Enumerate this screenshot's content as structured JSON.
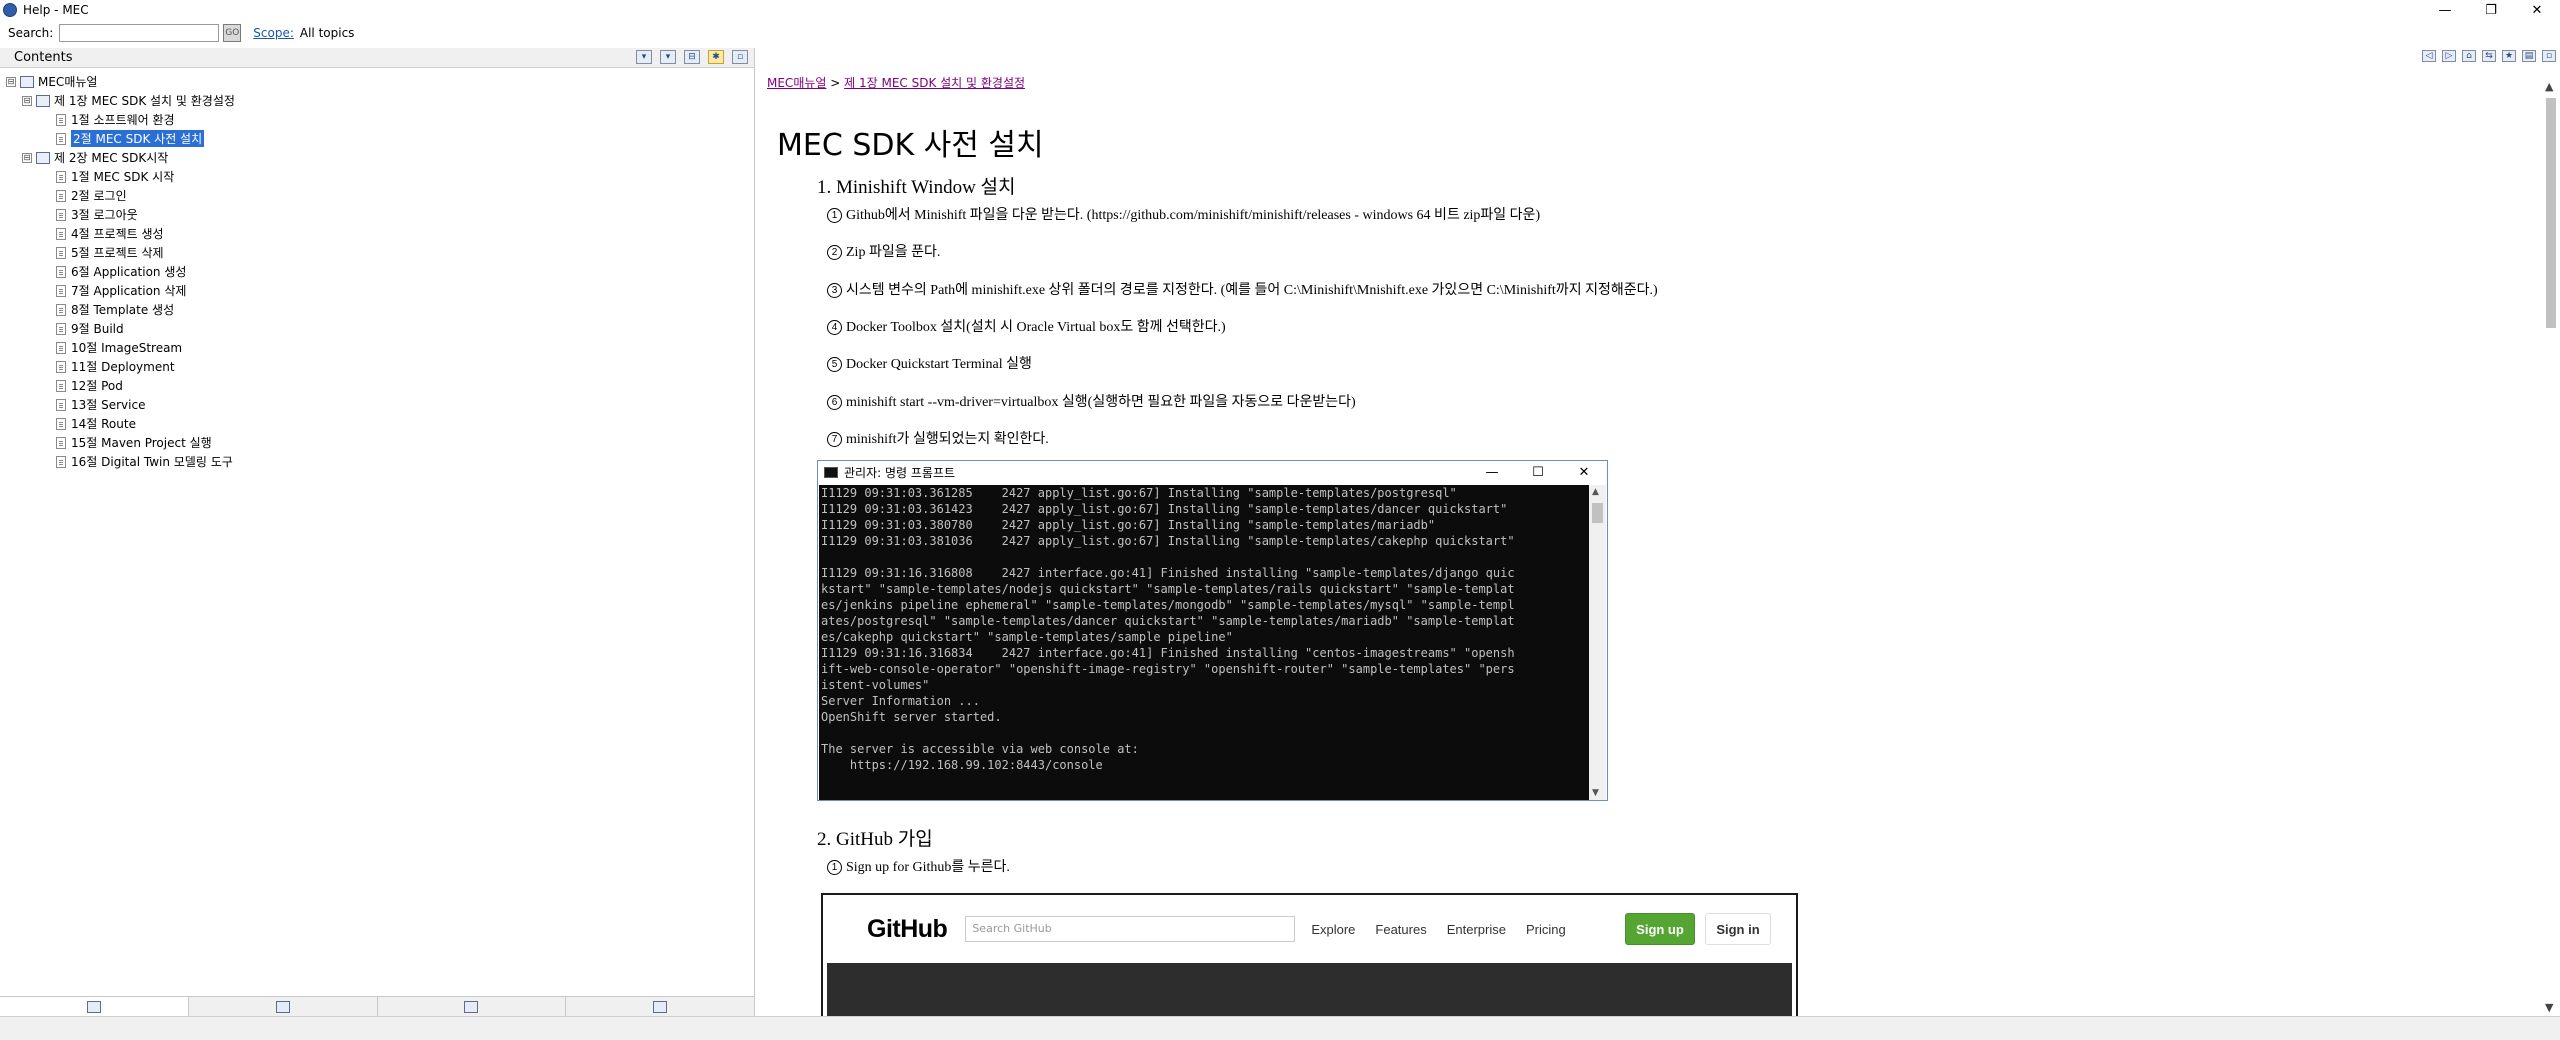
{
  "window": {
    "title": "Help - MEC",
    "controls": [
      "—",
      "❐",
      "✕"
    ]
  },
  "search": {
    "label": "Search:",
    "value": "",
    "go_label": "GO",
    "scope_link": "Scope:",
    "scope_value": "All topics"
  },
  "contents": {
    "header": "Contents",
    "tree": [
      {
        "label": "MEC매뉴얼",
        "level": 0,
        "type": "book",
        "toggle": "⊟"
      },
      {
        "label": "제 1장 MEC SDK 설치 및 환경설정",
        "level": 1,
        "type": "book",
        "toggle": "⊟"
      },
      {
        "label": "1절 소프트웨어 환경",
        "level": 2,
        "type": "page"
      },
      {
        "label": "2절 MEC SDK 사전 설치",
        "level": 2,
        "type": "page",
        "selected": true
      },
      {
        "label": "제 2장 MEC SDK시작",
        "level": 1,
        "type": "book",
        "toggle": "⊟"
      },
      {
        "label": "1절 MEC SDK 시작",
        "level": 2,
        "type": "page"
      },
      {
        "label": "2절 로그인",
        "level": 2,
        "type": "page"
      },
      {
        "label": "3절 로그아웃",
        "level": 2,
        "type": "page"
      },
      {
        "label": "4절 프로젝트 생성",
        "level": 2,
        "type": "page"
      },
      {
        "label": "5절 프로젝트 삭제",
        "level": 2,
        "type": "page"
      },
      {
        "label": "6절 Application 생성",
        "level": 2,
        "type": "page"
      },
      {
        "label": "7절 Application 삭제",
        "level": 2,
        "type": "page"
      },
      {
        "label": "8절 Template 생성",
        "level": 2,
        "type": "page"
      },
      {
        "label": "9절 Build",
        "level": 2,
        "type": "page"
      },
      {
        "label": "10절 ImageStream",
        "level": 2,
        "type": "page"
      },
      {
        "label": "11절 Deployment",
        "level": 2,
        "type": "page"
      },
      {
        "label": "12절 Pod",
        "level": 2,
        "type": "page"
      },
      {
        "label": "13절 Service",
        "level": 2,
        "type": "page"
      },
      {
        "label": "14절 Route",
        "level": 2,
        "type": "page"
      },
      {
        "label": "15절 Maven Project 실행",
        "level": 2,
        "type": "page"
      },
      {
        "label": "16절 Digital Twin 모델링 도구",
        "level": 2,
        "type": "page"
      }
    ]
  },
  "article": {
    "breadcrumb": [
      "MEC매뉴얼",
      " > ",
      "제 1장 MEC SDK 설치 및 환경설정"
    ],
    "title": "MEC SDK 사전 설치",
    "section1": "1. Minishift Window 설치",
    "steps1": [
      {
        "num": "1",
        "text": "Github에서 Minishift 파일을 다운 받는다. (https://github.com/minishift/minishift/releases - windows 64 비트 zip파일 다운)"
      },
      {
        "num": "2",
        "text": "Zip 파일을 푼다."
      },
      {
        "num": "3",
        "text": "시스템 변수의 Path에 minishift.exe 상위 폴더의 경로를 지정한다. (예를 들어 C:\\Minishift\\Mnishift.exe 가있으면 C:\\Minishift까지 지정해준다.)"
      },
      {
        "num": "4",
        "text": "Docker Toolbox 설치(설치 시 Oracle Virtual box도 함께 선택한다.)"
      },
      {
        "num": "5",
        "text": "Docker Quickstart Terminal 실행"
      },
      {
        "num": "6",
        "text": "minishift start --vm-driver=virtualbox 실행(실행하면 필요한 파일을 자동으로 다운받는다)"
      },
      {
        "num": "7",
        "text": "minishift가 실행되었는지 확인한다."
      }
    ],
    "section2": "2. GitHub 가입",
    "steps2": [
      {
        "num": "1",
        "text": "Sign up for Github를 누른다."
      }
    ]
  },
  "console": {
    "title": "관리자: 명령 프롬프트",
    "lines": [
      "I1129 09:31:03.361285    2427 apply_list.go:67] Installing \"sample-templates/postgresql\"",
      "I1129 09:31:03.361423    2427 apply_list.go:67] Installing \"sample-templates/dancer quickstart\"",
      "I1129 09:31:03.380780    2427 apply_list.go:67] Installing \"sample-templates/mariadb\"",
      "I1129 09:31:03.381036    2427 apply_list.go:67] Installing \"sample-templates/cakephp quickstart\"",
      "",
      "I1129 09:31:16.316808    2427 interface.go:41] Finished installing \"sample-templates/django quic",
      "kstart\" \"sample-templates/nodejs quickstart\" \"sample-templates/rails quickstart\" \"sample-templat",
      "es/jenkins pipeline ephemeral\" \"sample-templates/mongodb\" \"sample-templates/mysql\" \"sample-templ",
      "ates/postgresql\" \"sample-templates/dancer quickstart\" \"sample-templates/mariadb\" \"sample-templat",
      "es/cakephp quickstart\" \"sample-templates/sample pipeline\"",
      "I1129 09:31:16.316834    2427 interface.go:41] Finished installing \"centos-imagestreams\" \"opensh",
      "ift-web-console-operator\" \"openshift-image-registry\" \"openshift-router\" \"sample-templates\" \"pers",
      "istent-volumes\"",
      "Server Information ...",
      "OpenShift server started.",
      "",
      "The server is accessible via web console at:",
      "    https://192.168.99.102:8443/console"
    ]
  },
  "github": {
    "logo": "GitHub",
    "search_placeholder": "Search GitHub",
    "nav": [
      "Explore",
      "Features",
      "Enterprise",
      "Pricing"
    ],
    "signup": "Sign up",
    "signin": "Sign in"
  }
}
